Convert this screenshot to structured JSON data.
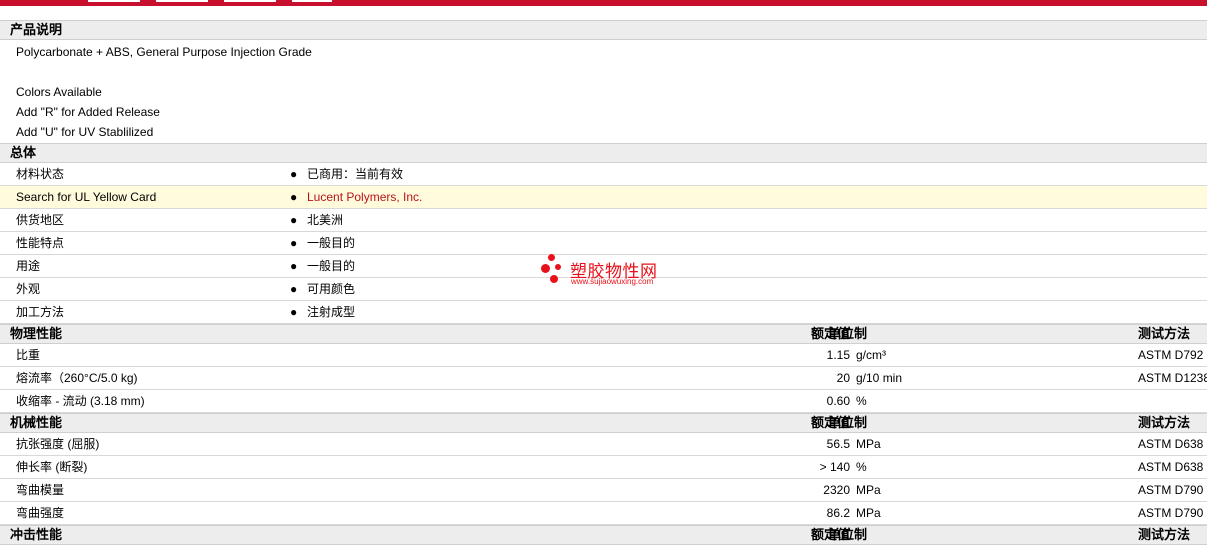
{
  "sections": {
    "description": {
      "title": "产品说明",
      "lines": [
        "Polycarbonate + ABS, General Purpose Injection Grade",
        "",
        "Colors Available",
        "Add \"R\" for Added Release",
        "Add \"U\" for UV Stablilized"
      ]
    },
    "general": {
      "title": "总体",
      "rows": [
        {
          "label": "材料状态",
          "value": "已商用：当前有效"
        },
        {
          "label": "Search for UL Yellow Card",
          "value": "Lucent Polymers, Inc."
        },
        {
          "label": "供货地区",
          "value": "北美洲"
        },
        {
          "label": "性能特点",
          "value": "一般目的"
        },
        {
          "label": "用途",
          "value": "一般目的"
        },
        {
          "label": "外观",
          "value": "可用颜色"
        },
        {
          "label": "加工方法",
          "value": "注射成型"
        }
      ]
    },
    "physical": {
      "title": "物理性能",
      "rows": [
        {
          "label": "比重",
          "value": "1.15",
          "unit": "g/cm³",
          "test": "ASTM D792"
        },
        {
          "label": "熔流率（260°C/5.0 kg)",
          "value": "20",
          "unit": "g/10 min",
          "test": "ASTM D1238"
        },
        {
          "label": "收缩率 - 流动 (3.18 mm)",
          "value": "0.60",
          "unit": "%",
          "test": ""
        }
      ]
    },
    "mechanical": {
      "title": "机械性能",
      "rows": [
        {
          "label": "抗张强度 (屈服)",
          "value": "56.5",
          "unit": "MPa",
          "test": "ASTM D638"
        },
        {
          "label": "伸长率 (断裂)",
          "value": "> 140",
          "unit": "%",
          "test": "ASTM D638"
        },
        {
          "label": "弯曲模量",
          "value": "2320",
          "unit": "MPa",
          "test": "ASTM D790"
        },
        {
          "label": "弯曲强度",
          "value": "86.2",
          "unit": "MPa",
          "test": "ASTM D790"
        }
      ]
    },
    "impact": {
      "title": "冲击性能"
    }
  },
  "column_headers": {
    "value": "额定值",
    "unit": "单位制",
    "test": "测试方法"
  },
  "watermark": {
    "name": "塑胶物性网",
    "url": "www.sujiaowuxing.com"
  },
  "colors": {
    "brand": "#c8102e",
    "link": "#b8141a",
    "highlight": "#fffbdc"
  }
}
